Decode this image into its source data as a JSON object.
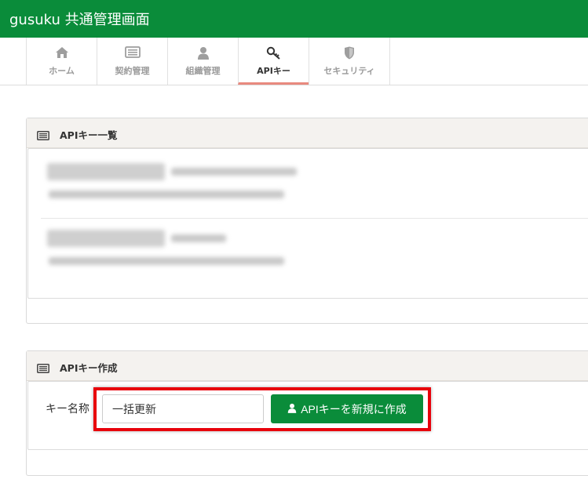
{
  "app": {
    "title": "gusuku 共通管理画面"
  },
  "tabs": [
    {
      "label": "ホーム",
      "icon": "home-icon"
    },
    {
      "label": "契約管理",
      "icon": "contract-list-icon"
    },
    {
      "label": "組織管理",
      "icon": "user-icon"
    },
    {
      "label": "APIキー",
      "icon": "key-icon",
      "active": true
    },
    {
      "label": "セキュリティ",
      "icon": "shield-icon"
    }
  ],
  "api_list": {
    "title": "APIキー一覧",
    "icon": "list-icon"
  },
  "api_create": {
    "title": "APIキー作成",
    "icon": "list-icon",
    "key_name_label": "キー名称",
    "key_name_value": "一括更新",
    "create_button_label": "APIキーを新規に作成",
    "create_button_icon": "user-icon"
  },
  "colors": {
    "brand_green": "#0a8c3a",
    "highlight_red": "#e8000b",
    "active_tab_underline": "#e8897e"
  }
}
